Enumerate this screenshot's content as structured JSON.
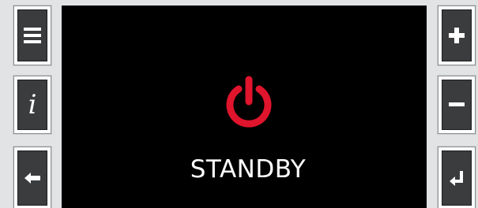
{
  "display": {
    "status_label": "STANDBY",
    "power_icon": "power-icon",
    "power_color": "#e0142c"
  },
  "left_keys": [
    {
      "icon": "menu-icon"
    },
    {
      "icon": "info-icon",
      "glyph": "i"
    },
    {
      "icon": "back-arrow-icon"
    }
  ],
  "right_keys": [
    {
      "icon": "plus-icon"
    },
    {
      "icon": "minus-icon"
    },
    {
      "icon": "enter-icon"
    }
  ]
}
